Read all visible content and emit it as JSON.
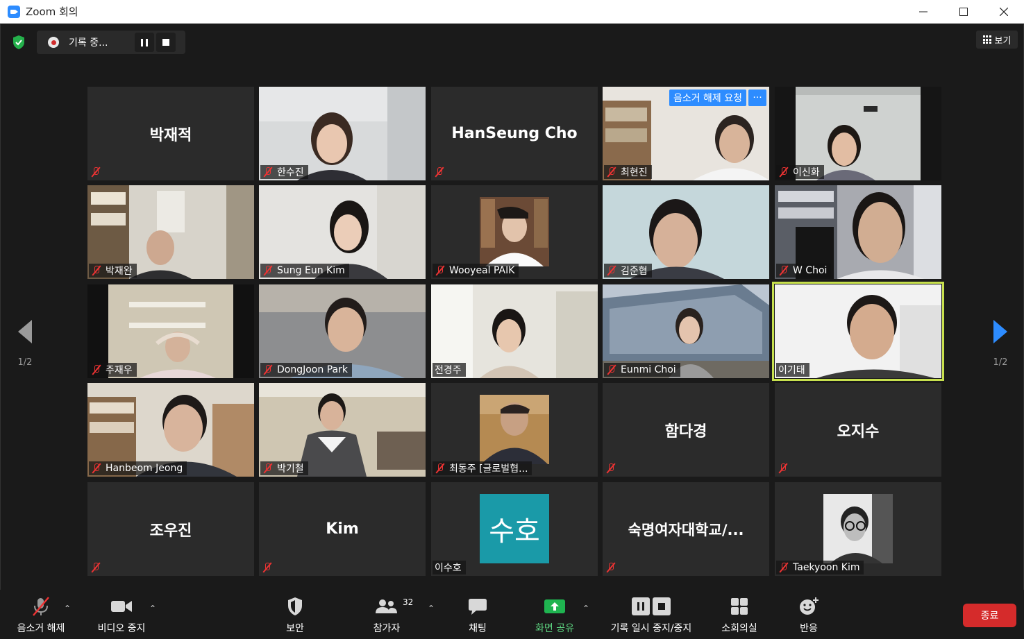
{
  "window": {
    "title": "Zoom 회의"
  },
  "recording": {
    "label": "기록 중..."
  },
  "view": {
    "label": "보기"
  },
  "pagination": {
    "left": "1/2",
    "right": "1/2"
  },
  "tiles": [
    {
      "name": "박재적",
      "center": "박재적",
      "muted": true
    },
    {
      "name": "한수진",
      "muted": true
    },
    {
      "name": "HanSeung Cho",
      "center": "HanSeung Cho",
      "muted": true
    },
    {
      "name": "최현진",
      "muted": true,
      "request": "음소거 해제 요청",
      "more": "···"
    },
    {
      "name": "이신화",
      "muted": true
    },
    {
      "name": "박재완",
      "muted": true
    },
    {
      "name": "Sung Eun Kim",
      "muted": true
    },
    {
      "name": "Wooyeal PAIK",
      "muted": true
    },
    {
      "name": "김준협",
      "muted": true
    },
    {
      "name": "W Choi",
      "muted": true
    },
    {
      "name": "주재우",
      "muted": true
    },
    {
      "name": "DongJoon Park",
      "muted": true
    },
    {
      "name": "전경주",
      "muted": false
    },
    {
      "name": "Eunmi Choi",
      "muted": true
    },
    {
      "name": "이기태",
      "muted": false,
      "active": true
    },
    {
      "name": "Hanbeom Jeong",
      "muted": true
    },
    {
      "name": "박기철",
      "muted": true
    },
    {
      "name": "최동주 [글로벌협...",
      "muted": true
    },
    {
      "name": "함다경",
      "center": "함다경",
      "muted": true
    },
    {
      "name": "오지수",
      "center": "오지수",
      "muted": true
    },
    {
      "name": "조우진",
      "center": "조우진",
      "muted": true
    },
    {
      "name": "Kim",
      "center": "Kim",
      "muted": true
    },
    {
      "name": "이수호",
      "muted": false,
      "avatar_text": "수호"
    },
    {
      "name": "숙명여자대학교/...",
      "center": "숙명여자대학교/...",
      "muted": true
    },
    {
      "name": "Taekyoon Kim",
      "muted": true
    }
  ],
  "toolbar": {
    "unmute": "음소거 해제",
    "video": "비디오 중지",
    "security": "보안",
    "participants": "참가자",
    "participants_count": "32",
    "chat": "채팅",
    "share": "화면 공유",
    "record": "기록 일시 중지/중지",
    "breakout": "소회의실",
    "reactions": "반응",
    "end": "종료"
  },
  "colors": {
    "accent": "#2d8cff",
    "share_green": "#5cd27f",
    "end_red": "#d52b2b",
    "active_speaker": "#c7e04e"
  }
}
